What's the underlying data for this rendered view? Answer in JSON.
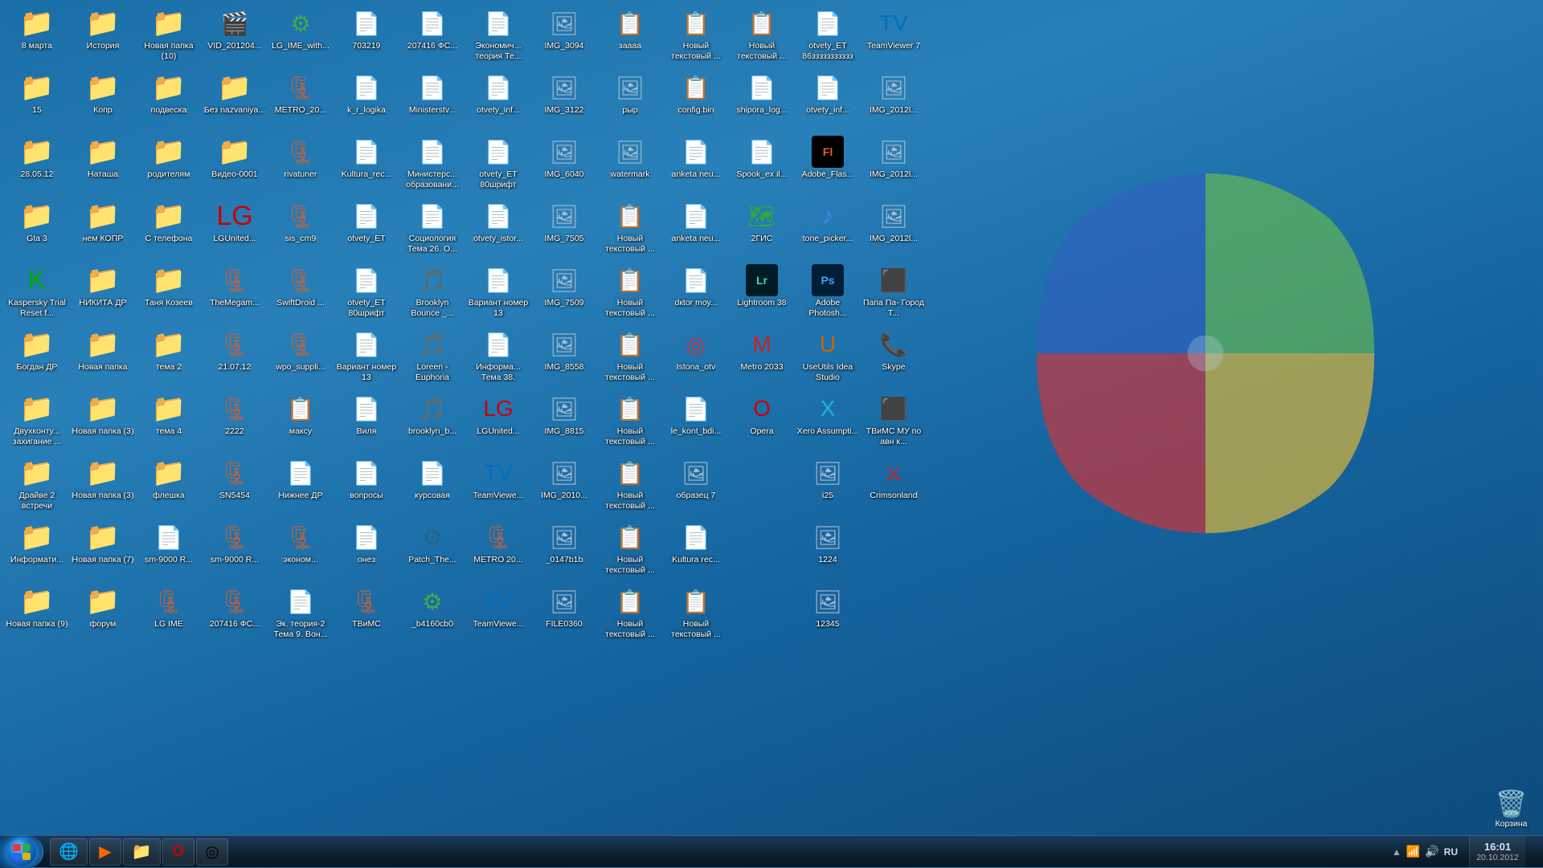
{
  "desktop": {
    "icons": [
      {
        "id": "8marta",
        "label": "8 марта",
        "type": "folder",
        "col": 0
      },
      {
        "id": "15",
        "label": "15",
        "type": "folder",
        "col": 0
      },
      {
        "id": "28.05.12",
        "label": "28.05.12",
        "type": "folder",
        "col": 0
      },
      {
        "id": "gta3",
        "label": "Gta 3",
        "type": "folder-blue",
        "col": 0
      },
      {
        "id": "kaspersky",
        "label": "Kaspersky Trial Reset f...",
        "type": "folder-blue",
        "col": 0
      },
      {
        "id": "bogdan",
        "label": "Богдан ДР",
        "type": "folder-blue",
        "col": 0
      },
      {
        "id": "dvuhkon",
        "label": "Двухконту... захигание ...",
        "type": "folder-blue",
        "col": 0
      },
      {
        "id": "draive",
        "label": "Драйве 2 встречи",
        "type": "folder-blue",
        "col": 0
      },
      {
        "id": "informati",
        "label": "Информати...",
        "type": "folder-blue",
        "col": 0
      },
      {
        "id": "novayap9",
        "label": "Новая папка (9)",
        "type": "folder",
        "col": 0
      },
      {
        "id": "istoriya",
        "label": "История",
        "type": "folder",
        "col": 1
      },
      {
        "id": "kopr",
        "label": "Копр",
        "type": "folder",
        "col": 1
      },
      {
        "id": "natasha",
        "label": "Наташа",
        "type": "folder",
        "col": 1
      },
      {
        "id": "nemkop",
        "label": "нем КОПР",
        "type": "folder",
        "col": 1
      },
      {
        "id": "nikitadr",
        "label": "НИКИТА ДР",
        "type": "folder",
        "col": 1
      },
      {
        "id": "novayap",
        "label": "Новая папка",
        "type": "folder",
        "col": 1
      },
      {
        "id": "novayap3",
        "label": "Новая папка (3)",
        "type": "folder",
        "col": 1
      },
      {
        "id": "novayap4",
        "label": "Новая папка (3)",
        "type": "folder",
        "col": 1
      },
      {
        "id": "novayap7",
        "label": "Новая папка (7)",
        "type": "folder",
        "col": 1
      },
      {
        "id": "forum",
        "label": "форум",
        "type": "folder",
        "col": 1
      },
      {
        "id": "novayap10",
        "label": "Новая папка (10)",
        "type": "folder",
        "col": 2
      },
      {
        "id": "podveski",
        "label": "подвеска",
        "type": "folder",
        "col": 2
      },
      {
        "id": "roditelyam",
        "label": "родителям",
        "type": "folder",
        "col": 2
      },
      {
        "id": "stenafona",
        "label": "С телефона",
        "type": "folder",
        "col": 2
      },
      {
        "id": "tanya",
        "label": "Таня Козеев",
        "type": "folder",
        "col": 2
      },
      {
        "id": "tema2",
        "label": "тема 2",
        "type": "folder",
        "col": 2
      },
      {
        "id": "tema4",
        "label": "тема 4",
        "type": "folder",
        "col": 2
      },
      {
        "id": "vishka",
        "label": "флешка",
        "type": "folder",
        "col": 2
      },
      {
        "id": "sm9000",
        "label": "sm-9000 R...",
        "type": "word",
        "col": 2
      },
      {
        "id": "lgime",
        "label": "LG IME",
        "type": "zip",
        "col": 2
      },
      {
        "id": "vid2012041",
        "label": "VID_201204...",
        "type": "video",
        "col": 3
      },
      {
        "id": "beznaz",
        "label": "Без nazvaniya...",
        "type": "folder",
        "col": 3
      },
      {
        "id": "video0001",
        "label": "Видео-0001",
        "type": "folder",
        "col": 3
      },
      {
        "id": "lgunited",
        "label": "LGUnited...",
        "type": "folder",
        "col": 3
      },
      {
        "id": "themegam",
        "label": "TheMegam...",
        "type": "zip",
        "col": 3
      },
      {
        "id": "21.07.12",
        "label": "21.07.12",
        "type": "zip",
        "col": 3
      },
      {
        "id": "2222",
        "label": "2222",
        "type": "zip",
        "col": 3
      },
      {
        "id": "sn5454",
        "label": "SN5454",
        "type": "zip",
        "col": 3
      },
      {
        "id": "sm9000r",
        "label": "sm-9000 R...",
        "type": "zip",
        "col": 3
      },
      {
        "id": "207416fc2",
        "label": "207416 ФС...",
        "type": "zip",
        "col": 3
      },
      {
        "id": "lg_ime_with",
        "label": "LG_IME_with...",
        "type": "exe",
        "col": 4
      },
      {
        "id": "metro20",
        "label": "METRO_20...",
        "type": "zip",
        "col": 4
      },
      {
        "id": "rivatuner",
        "label": "rivatuner",
        "type": "zip",
        "col": 4
      },
      {
        "id": "sis_cm9",
        "label": "sis_cm9",
        "type": "zip",
        "col": 4
      },
      {
        "id": "swiftdroid",
        "label": "SwiftDroid ...",
        "type": "zip",
        "col": 4
      },
      {
        "id": "wpo_suppli",
        "label": "wpo_suppli...",
        "type": "zip",
        "col": 4
      },
      {
        "id": "maksy",
        "label": "максу",
        "type": "txt",
        "col": 4
      },
      {
        "id": "nishnee",
        "label": "Нижнее ДР",
        "type": "word",
        "col": 4
      },
      {
        "id": "ekonomites",
        "label": "эконом...",
        "type": "zip",
        "col": 4
      },
      {
        "id": "teoriya2",
        "label": "Эк. теория-2 Тема 9. Вон...",
        "type": "word",
        "col": 4
      },
      {
        "id": "703219",
        "label": "703219",
        "type": "word",
        "col": 5
      },
      {
        "id": "krlogika",
        "label": "k_r_logika",
        "type": "word",
        "col": 5
      },
      {
        "id": "kultura_rec",
        "label": "Kultura_rec...",
        "type": "word",
        "col": 5
      },
      {
        "id": "otvety_et",
        "label": "otvety_ET",
        "type": "word",
        "col": 5
      },
      {
        "id": "otvety_et2",
        "label": "otvety_ET 80шрифт",
        "type": "word",
        "col": 5
      },
      {
        "id": "variantnomer",
        "label": "Вариант номер 13",
        "type": "word",
        "col": 5
      },
      {
        "id": "vila",
        "label": "Виля",
        "type": "word",
        "col": 5
      },
      {
        "id": "voprosy",
        "label": "вопросы",
        "type": "word",
        "col": 5
      },
      {
        "id": "svyaz",
        "label": "онез",
        "type": "word",
        "col": 5
      },
      {
        "id": "tbmc",
        "label": "ТВиМС",
        "type": "zip",
        "col": 5
      },
      {
        "id": "207416fc",
        "label": "207416 ФС...",
        "type": "word",
        "col": 6
      },
      {
        "id": "ministerst",
        "label": "Ministerstv...",
        "type": "word",
        "col": 6
      },
      {
        "id": "ministertv",
        "label": "Министерс... образовани...",
        "type": "word",
        "col": 6
      },
      {
        "id": "sociologiya",
        "label": "Социология Тема 26. О...",
        "type": "word",
        "col": 6
      },
      {
        "id": "brooklyn_b",
        "label": "Brooklyn Bounce _...",
        "type": "mp3",
        "col": 6
      },
      {
        "id": "loreen",
        "label": "Loreen - Euphoria",
        "type": "mp3",
        "col": 6
      },
      {
        "id": "brooklyn_b2",
        "label": "brooklyn_b...",
        "type": "mp3",
        "col": 6
      },
      {
        "id": "kursovaя",
        "label": "курсовая",
        "type": "word",
        "col": 6
      },
      {
        "id": "patch_the",
        "label": "Patch_The...",
        "type": "exe",
        "col": 6
      },
      {
        "id": "c84160cb",
        "label": "_b4160cb0",
        "type": "exe",
        "col": 6
      },
      {
        "id": "ekonom",
        "label": "Экономич... теория Те...",
        "type": "word",
        "col": 7
      },
      {
        "id": "otvety_inf",
        "label": "otvety_inf...",
        "type": "word",
        "col": 7
      },
      {
        "id": "otvety_istor",
        "label": "otvety_ET 80шрифт",
        "type": "word",
        "col": 7
      },
      {
        "id": "otvety_istor2",
        "label": "otvety_istor...",
        "type": "word",
        "col": 7
      },
      {
        "id": "variantnomer2",
        "label": "Вариант номер 13",
        "type": "word",
        "col": 7
      },
      {
        "id": "informa38",
        "label": "Информа... Тема 38.",
        "type": "word",
        "col": 7
      },
      {
        "id": "lgunited2",
        "label": "LGUnited...",
        "type": "exe",
        "col": 7
      },
      {
        "id": "teamview2",
        "label": "TeamViewe...",
        "type": "exe",
        "col": 7
      },
      {
        "id": "metro204",
        "label": "МETRO 20...",
        "type": "zip",
        "col": 7
      },
      {
        "id": "teamview3",
        "label": "TeamViewe...",
        "type": "exe",
        "col": 7
      },
      {
        "id": "img3094",
        "label": "IMG_3094",
        "type": "img",
        "col": 8
      },
      {
        "id": "img3122",
        "label": "IMG_3122",
        "type": "img",
        "col": 8
      },
      {
        "id": "img6040",
        "label": "IMG_6040",
        "type": "img",
        "col": 8
      },
      {
        "id": "img7505",
        "label": "IMG_7505",
        "type": "img",
        "col": 8
      },
      {
        "id": "img7509",
        "label": "IMG_7509",
        "type": "img",
        "col": 8
      },
      {
        "id": "img8558",
        "label": "IMG_8558",
        "type": "img",
        "col": 8
      },
      {
        "id": "img8815",
        "label": "IMG_8815",
        "type": "img",
        "col": 8
      },
      {
        "id": "img20102",
        "label": "IMG_2010...",
        "type": "img",
        "col": 8
      },
      {
        "id": "z0147b1b",
        "label": "_0147b1b",
        "type": "img",
        "col": 8
      },
      {
        "id": "file0360",
        "label": "FILE0360",
        "type": "img",
        "col": 8
      },
      {
        "id": "zaааа",
        "label": "заааа",
        "type": "txt",
        "col": 9
      },
      {
        "id": "ryp",
        "label": "рыр",
        "type": "img",
        "col": 9
      },
      {
        "id": "watermark",
        "label": "watermark",
        "type": "img",
        "col": 9
      },
      {
        "id": "novyitek1",
        "label": "Новый текстовый ...",
        "type": "txt",
        "col": 9
      },
      {
        "id": "novyitek2",
        "label": "Новый текстовый ...",
        "type": "txt",
        "col": 9
      },
      {
        "id": "novyitek3",
        "label": "Новый текстовый ...",
        "type": "txt",
        "col": 9
      },
      {
        "id": "novyitek4",
        "label": "Новый текстовый ...",
        "type": "txt",
        "col": 9
      },
      {
        "id": "novyitek5",
        "label": "Новый текстовый ...",
        "type": "txt",
        "col": 9
      },
      {
        "id": "novyitek6",
        "label": "Новый текстовый ...",
        "type": "txt",
        "col": 9
      },
      {
        "id": "novyitek7",
        "label": "Новый текстовый ...",
        "type": "txt",
        "col": 9
      },
      {
        "id": "novyitek8",
        "label": "Новый текстовый ...",
        "type": "txt",
        "col": 10
      },
      {
        "id": "configbin",
        "label": "config.bin",
        "type": "txt",
        "col": 10
      },
      {
        "id": "anketanew",
        "label": "anketa neu...",
        "type": "word",
        "col": 10
      },
      {
        "id": "anketanew2",
        "label": "anketa neu...",
        "type": "word",
        "col": 10
      },
      {
        "id": "dectormoу",
        "label": "dкtor mоу...",
        "type": "word",
        "col": 10
      },
      {
        "id": "stona_otv",
        "label": "Istona_otv",
        "type": "app",
        "col": 10
      },
      {
        "id": "lekontbdi",
        "label": "le_kont_bdi...",
        "type": "word",
        "col": 10
      },
      {
        "id": "obrazets",
        "label": "образец 7",
        "type": "img",
        "col": 10
      },
      {
        "id": "kultura_rec2",
        "label": "Kultura rec...",
        "type": "word",
        "col": 10
      },
      {
        "id": "novyitek9",
        "label": "Новый текстовый ...",
        "type": "txt",
        "col": 10
      },
      {
        "id": "novyytek",
        "label": "Новый текстовый ...",
        "type": "txt",
        "col": 11
      },
      {
        "id": "shipora_log",
        "label": "shipora_log...",
        "type": "word",
        "col": 11
      },
      {
        "id": "spook_ex",
        "label": "Spook_ex il...",
        "type": "word",
        "col": 11
      },
      {
        "id": "2gis",
        "label": "2ГИС",
        "type": "app",
        "col": 11
      },
      {
        "id": "lightroom38",
        "label": "Lightroom 38",
        "type": "app",
        "col": 11
      },
      {
        "id": "metro2033",
        "label": "Metro 2033",
        "type": "app",
        "col": 11
      },
      {
        "id": "opera",
        "label": "Opera",
        "type": "app",
        "col": 11
      },
      {
        "id": "otvetet",
        "label": "otvety_ET 86ззззззззззз",
        "type": "word",
        "col": 12
      },
      {
        "id": "otvety_inf2",
        "label": "otvety_inf...",
        "type": "word",
        "col": 12
      },
      {
        "id": "adobe_flash",
        "label": "Adobe_Flas...",
        "type": "app",
        "col": 12
      },
      {
        "id": "tone_picker",
        "label": "tone_picker...",
        "type": "app",
        "col": 12
      },
      {
        "id": "adobe_photo",
        "label": "Adobe Photosh...",
        "type": "app",
        "col": 12
      },
      {
        "id": "usebutils",
        "label": "UseUtils Idea Studio",
        "type": "app",
        "col": 12
      },
      {
        "id": "xeroassumpt",
        "label": "Xero Assumpti...",
        "type": "app",
        "col": 12
      },
      {
        "id": "i25",
        "label": "i25",
        "type": "img",
        "col": 12
      },
      {
        "id": "i1224",
        "label": "1224",
        "type": "img",
        "col": 12
      },
      {
        "id": "i12345",
        "label": "12345",
        "type": "img",
        "col": 12
      },
      {
        "id": "teamviewer7",
        "label": "TeamViewer 7",
        "type": "app",
        "col": 13
      },
      {
        "id": "img20121",
        "label": "IMG_2012l...",
        "type": "img",
        "col": 13
      },
      {
        "id": "img20122",
        "label": "IMG_2012l...",
        "type": "img",
        "col": 13
      },
      {
        "id": "img20123",
        "label": "IMG_2012l...",
        "type": "img",
        "col": 13
      },
      {
        "id": "papa",
        "label": "Папа Па- Город Т...",
        "type": "app",
        "col": 13
      },
      {
        "id": "skype",
        "label": "Skype",
        "type": "app",
        "col": 13
      },
      {
        "id": "tbmc2",
        "label": "ТВиМС МУ по авн к...",
        "type": "app",
        "col": 13
      },
      {
        "id": "crimsonland",
        "label": "Crimsonland",
        "type": "app",
        "col": 13
      }
    ]
  },
  "taskbar": {
    "start_label": "",
    "apps": [
      {
        "id": "start",
        "icon": "⊞",
        "label": ""
      },
      {
        "id": "ie",
        "icon": "🌐",
        "label": ""
      },
      {
        "id": "wmplayer",
        "icon": "▶",
        "label": ""
      },
      {
        "id": "explorer",
        "icon": "📁",
        "label": ""
      },
      {
        "id": "opera_tb",
        "icon": "O",
        "label": ""
      },
      {
        "id": "chrome",
        "icon": "◎",
        "label": ""
      }
    ],
    "tray": {
      "lang": "RU",
      "time": "16:01",
      "date": "20.10.2012"
    }
  },
  "trash": {
    "label": "Корзина"
  }
}
